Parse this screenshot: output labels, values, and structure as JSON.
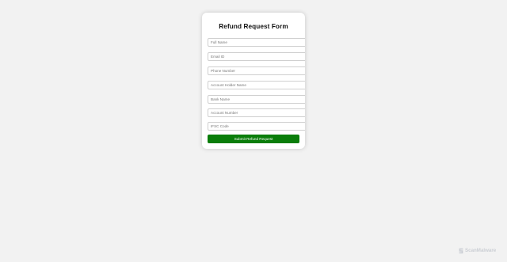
{
  "form": {
    "title": "Refund Request Form",
    "fields": [
      {
        "placeholder": "Full Name",
        "value": ""
      },
      {
        "placeholder": "Email ID",
        "value": ""
      },
      {
        "placeholder": "Phone Number",
        "value": ""
      },
      {
        "placeholder": "Account Holder Name",
        "value": ""
      },
      {
        "placeholder": "Bank Name",
        "value": ""
      },
      {
        "placeholder": "Account Number",
        "value": ""
      },
      {
        "placeholder": "IFSC Code",
        "value": ""
      }
    ],
    "submit_label": "Submit Refund Request"
  },
  "watermark": {
    "text": "ScanMalware",
    "icon": "scanmalware-logo-icon"
  },
  "colors": {
    "background": "#f2f2f2",
    "card": "#ffffff",
    "submit_button": "#0a7d0a",
    "watermark": "#c7cbd1"
  }
}
